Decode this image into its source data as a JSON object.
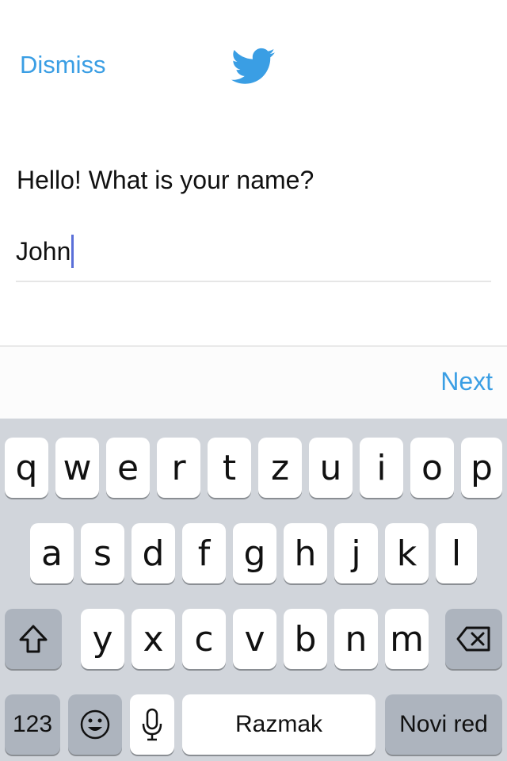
{
  "header": {
    "dismiss_label": "Dismiss",
    "logo_icon": "twitter-bird-icon",
    "accent_color": "#3a9ee4"
  },
  "prompt": {
    "question": "Hello! What is your name?",
    "name_value": "John"
  },
  "toolbar": {
    "next_label": "Next"
  },
  "keyboard": {
    "row1": [
      "q",
      "w",
      "e",
      "r",
      "t",
      "z",
      "u",
      "i",
      "o",
      "p"
    ],
    "row2": [
      "a",
      "s",
      "d",
      "f",
      "g",
      "h",
      "j",
      "k",
      "l"
    ],
    "row3": [
      "y",
      "x",
      "c",
      "v",
      "b",
      "n",
      "m"
    ],
    "shift_icon": "shift-icon",
    "backspace_icon": "backspace-icon",
    "numbers_label": "123",
    "emoji_icon": "emoji-icon",
    "mic_icon": "microphone-icon",
    "space_label": "Razmak",
    "return_label": "Novi red"
  }
}
